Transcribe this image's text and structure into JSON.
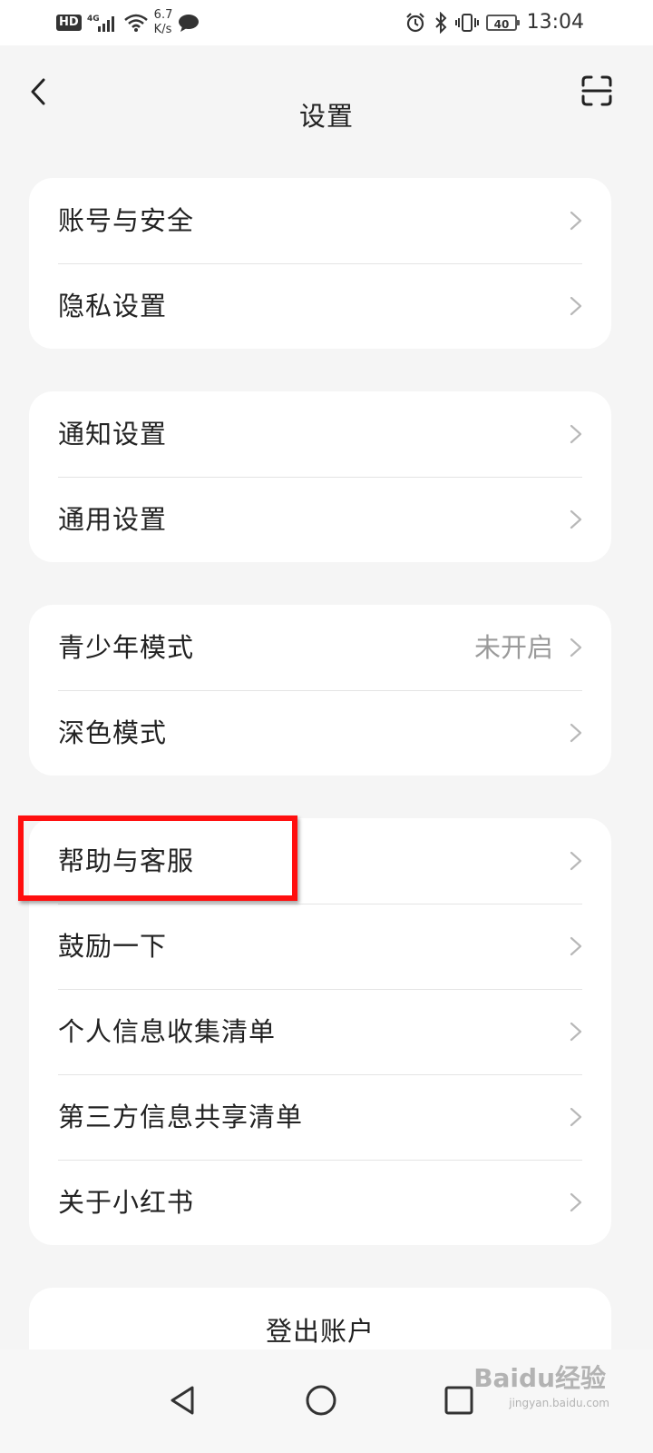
{
  "status_bar": {
    "hd": "HD",
    "network": "4G",
    "speed_value": "6.7",
    "speed_unit": "K/s",
    "battery": "40",
    "time": "13:04"
  },
  "header": {
    "title": "设置"
  },
  "groups": [
    {
      "items": [
        {
          "label": "账号与安全"
        },
        {
          "label": "隐私设置"
        }
      ]
    },
    {
      "items": [
        {
          "label": "通知设置"
        },
        {
          "label": "通用设置"
        }
      ]
    },
    {
      "items": [
        {
          "label": "青少年模式",
          "value": "未开启"
        },
        {
          "label": "深色模式"
        }
      ]
    },
    {
      "items": [
        {
          "label": "帮助与客服"
        },
        {
          "label": "鼓励一下"
        },
        {
          "label": "个人信息收集清单"
        },
        {
          "label": "第三方信息共享清单"
        },
        {
          "label": "关于小红书"
        }
      ]
    }
  ],
  "logout_label": "登出账户",
  "watermark": {
    "main": "Baidu经验",
    "sub": "jingyan.baidu.com"
  },
  "colors": {
    "highlight": "#ff0f0f",
    "background": "#f5f5f5",
    "card": "#ffffff"
  }
}
